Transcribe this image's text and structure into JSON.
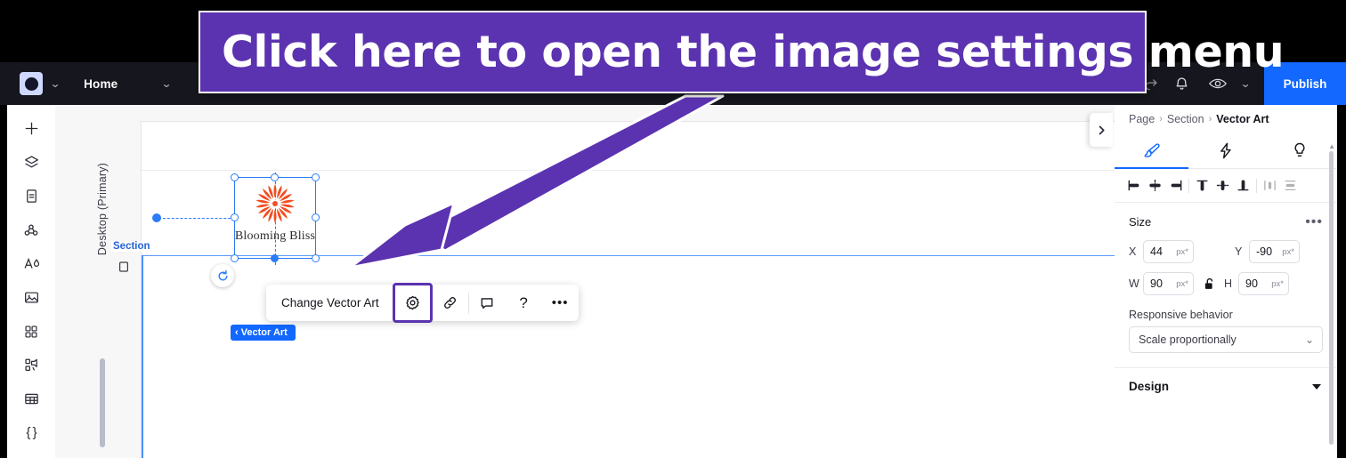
{
  "annotation": {
    "banner_text": "Click here to open the image settings menu",
    "accent_color": "#5b33b0"
  },
  "topbar": {
    "logo_icon": "editor-logo-icon",
    "logo_chevron_icon": "chevron-down-icon",
    "home_label": "Home",
    "home_chevron_icon": "chevron-down-icon",
    "save_status_icon": "cloud-check-icon",
    "redo_icon": "redo-icon",
    "notifications_icon": "bell-icon",
    "preview_icon": "eye-icon",
    "preview_chevron_icon": "chevron-down-icon",
    "publish_label": "Publish",
    "publish_color": "#1268ff"
  },
  "rail": {
    "items": [
      {
        "name": "add",
        "icon": "plus-icon"
      },
      {
        "name": "layers",
        "icon": "layers-icon"
      },
      {
        "name": "pages",
        "icon": "page-icon"
      },
      {
        "name": "site-structure",
        "icon": "nodes-icon"
      },
      {
        "name": "text-theme",
        "icon": "text-theme-icon"
      },
      {
        "name": "media",
        "icon": "image-icon"
      },
      {
        "name": "apps",
        "icon": "apps-grid-icon"
      },
      {
        "name": "marketing",
        "icon": "marketing-icon"
      },
      {
        "name": "tables",
        "icon": "table-icon"
      },
      {
        "name": "dev-mode",
        "icon": "code-braces-icon",
        "glyph": "{ }"
      }
    ]
  },
  "canvas": {
    "viewport_label": "Desktop (Primary)",
    "viewport_icon": "device-icon",
    "section_label": "Section",
    "logo_title": "Blooming Bliss",
    "logo_mark": "orange-sunburst-flower-icon",
    "rotate_icon": "rotate-icon",
    "element_badge": "Vector Art",
    "element_badge_chevron": "‹"
  },
  "element_toolbar": {
    "change_label": "Change Vector Art",
    "buttons": [
      {
        "name": "image-settings",
        "icon": "gear-icon",
        "focused": true
      },
      {
        "name": "link",
        "icon": "link-icon",
        "focused": false
      },
      {
        "name": "comment",
        "icon": "comment-icon",
        "focused": false
      },
      {
        "name": "help",
        "icon": "question-mark-icon",
        "focused": false,
        "glyph": "?"
      },
      {
        "name": "more-options",
        "icon": "ellipsis-icon",
        "focused": false,
        "glyph": "•••"
      }
    ]
  },
  "panel": {
    "collapse_icon": "chevron-right-icon",
    "breadcrumb": {
      "page": "Page",
      "separator": "›",
      "section": "Section",
      "current": "Vector Art"
    },
    "tabs": [
      {
        "name": "design",
        "icon": "brush-icon",
        "active": true
      },
      {
        "name": "interactions",
        "icon": "lightning-icon",
        "active": false
      },
      {
        "name": "tips",
        "icon": "lightbulb-icon",
        "active": false
      }
    ],
    "align_buttons": [
      {
        "name": "align-left",
        "icon": "align-left-icon",
        "dim": false
      },
      {
        "name": "align-center-horizontal",
        "icon": "align-center-h-icon",
        "dim": false
      },
      {
        "name": "align-right",
        "icon": "align-right-icon",
        "dim": false
      },
      {
        "name": "align-top",
        "icon": "align-top-icon",
        "dim": false
      },
      {
        "name": "align-middle-vertical",
        "icon": "align-middle-v-icon",
        "dim": false
      },
      {
        "name": "align-bottom",
        "icon": "align-bottom-icon",
        "dim": false
      },
      {
        "name": "distribute-horizontal",
        "icon": "distribute-h-icon",
        "dim": true
      },
      {
        "name": "distribute-vertical",
        "icon": "distribute-v-icon",
        "dim": true
      }
    ],
    "size": {
      "title": "Size",
      "more_icon": "ellipsis-icon",
      "x_label": "X",
      "x_value": "44",
      "x_unit": "px*",
      "y_label": "Y",
      "y_value": "-90",
      "y_unit": "px*",
      "w_label": "W",
      "w_value": "90",
      "w_unit": "px*",
      "h_label": "H",
      "h_value": "90",
      "h_unit": "px*",
      "lock_icon": "unlocked-padlock-icon"
    },
    "responsive": {
      "label": "Responsive behavior",
      "selected": "Scale proportionally",
      "chevron_icon": "chevron-down-icon"
    },
    "design_section": {
      "title": "Design",
      "chevron_icon": "triangle-down-icon"
    }
  }
}
